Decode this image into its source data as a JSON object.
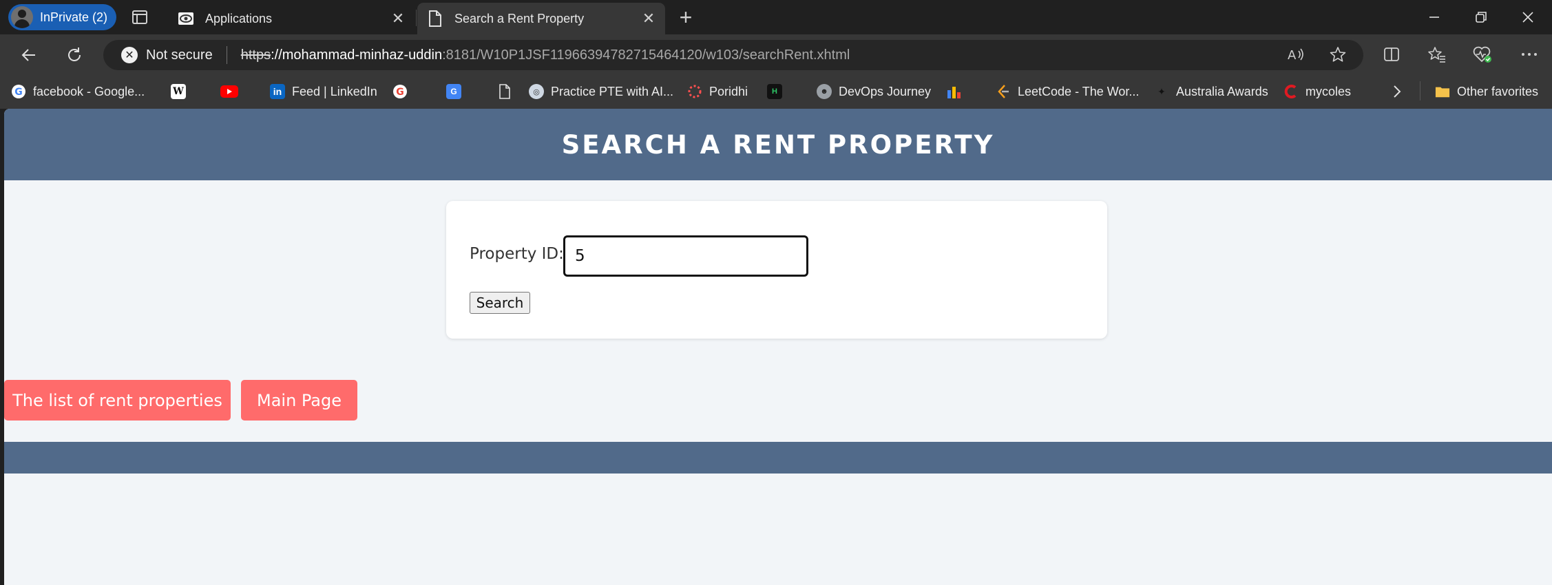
{
  "browser": {
    "profile_label": "InPrivate (2)",
    "tabs": [
      {
        "title": "Applications",
        "icon": "page-eye-icon"
      },
      {
        "title": "Search a Rent Property",
        "icon": "document-icon"
      }
    ],
    "address": {
      "security_label": "Not secure",
      "scheme": "https",
      "host": "://mohammad-minhaz-uddin",
      "path": ":8181/W10P1JSF11966394782715464120/w103/searchRent.xhtml"
    },
    "favorites": [
      {
        "label": "facebook - Google...",
        "icon": "google-icon"
      },
      {
        "label": "",
        "icon": "wikipedia-icon"
      },
      {
        "label": "",
        "icon": "youtube-icon"
      },
      {
        "label": "Feed | LinkedIn",
        "icon": "linkedin-icon"
      },
      {
        "label": "",
        "icon": "google-icon"
      },
      {
        "label": "",
        "icon": "google-translate-icon"
      },
      {
        "label": "",
        "icon": "document-icon"
      },
      {
        "label": "Practice PTE with AI...",
        "icon": "pte-icon"
      },
      {
        "label": "Poridhi",
        "icon": "poridhi-icon"
      },
      {
        "label": "",
        "icon": "hackerrank-icon"
      },
      {
        "label": "DevOps Journey",
        "icon": "devops-icon"
      },
      {
        "label": "",
        "icon": "chart-icon"
      },
      {
        "label": "LeetCode - The Wor...",
        "icon": "leetcode-icon"
      },
      {
        "label": "Australia Awards",
        "icon": "australia-awards-icon"
      },
      {
        "label": "mycoles",
        "icon": "coles-icon"
      }
    ],
    "other_favorites_label": "Other favorites"
  },
  "page": {
    "title": "SEARCH A RENT PROPERTY",
    "form": {
      "property_id_label": "Property ID:",
      "property_id_value": "5",
      "search_label": "Search"
    },
    "links": {
      "list_label": "The list of rent properties",
      "main_label": "Main Page"
    }
  },
  "colors": {
    "header": "#516a8a",
    "button": "#ff6b6b",
    "background": "#f2f5f8"
  }
}
